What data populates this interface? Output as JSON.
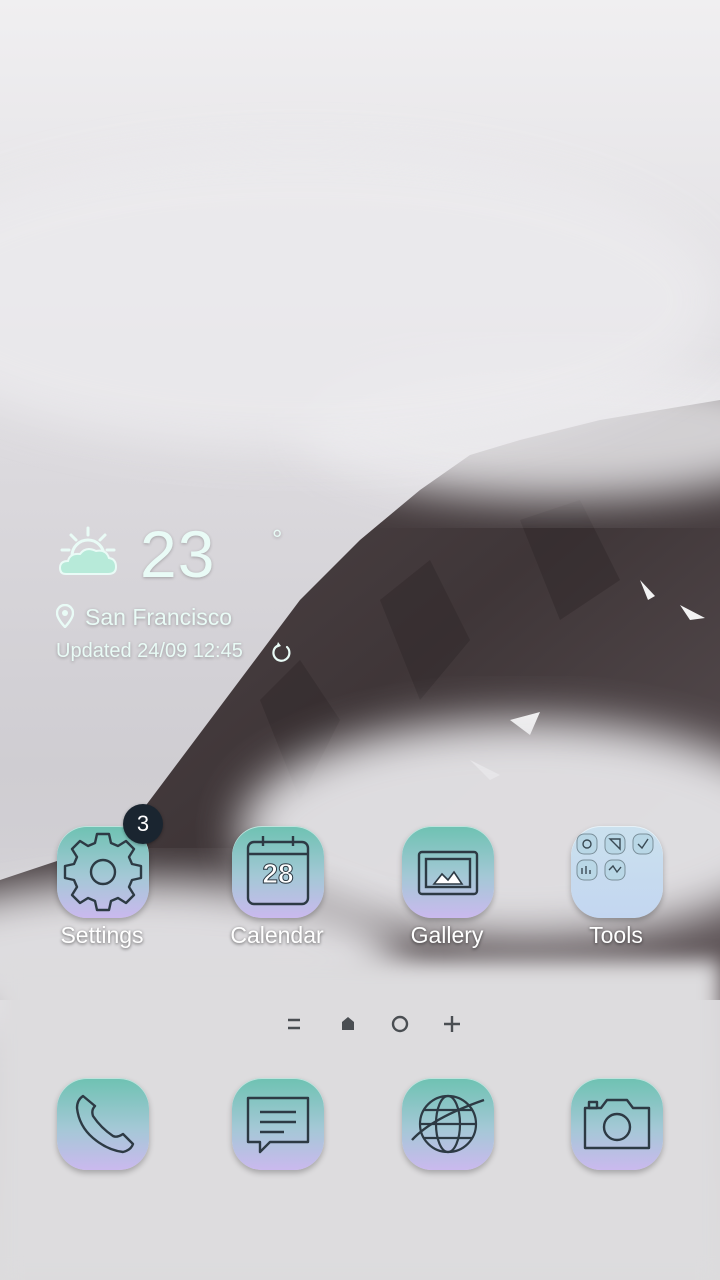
{
  "weather": {
    "temperature": "23",
    "degree_symbol": "°",
    "location": "San Francisco",
    "updated": "Updated 24/09 12:45",
    "icon": "partly-cloudy-icon"
  },
  "apps": [
    {
      "label": "Settings",
      "icon": "gear-icon",
      "badge": "3"
    },
    {
      "label": "Calendar",
      "icon": "calendar-icon",
      "calendar_day": "28"
    },
    {
      "label": "Gallery",
      "icon": "image-icon"
    },
    {
      "label": "Tools",
      "icon": "folder-icon"
    }
  ],
  "dock": [
    {
      "icon": "phone-icon"
    },
    {
      "icon": "messages-icon"
    },
    {
      "icon": "globe-icon"
    },
    {
      "icon": "camera-icon"
    }
  ],
  "page_indicators": [
    "menu-icon",
    "home-icon",
    "circle-icon",
    "plus-icon"
  ],
  "colors": {
    "icon_top": "#6ec2b2",
    "icon_bottom": "#cab9ee",
    "badge": "#1a2530"
  }
}
